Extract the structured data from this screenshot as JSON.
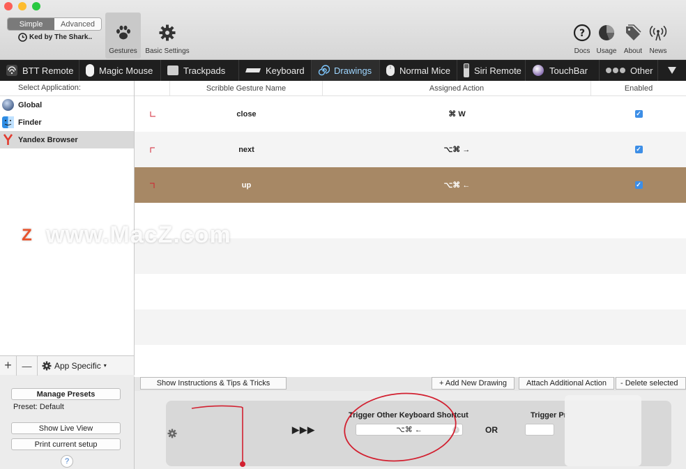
{
  "toolbar": {
    "mode_simple": "Simple",
    "mode_advanced": "Advanced",
    "user": "Ked by The Shark..",
    "gestures": "Gestures",
    "basic_settings": "Basic Settings",
    "docs": "Docs",
    "usage": "Usage",
    "about": "About",
    "news": "News"
  },
  "tabs": [
    {
      "label": "BTT Remote"
    },
    {
      "label": "Magic Mouse"
    },
    {
      "label": "Trackpads"
    },
    {
      "label": "Keyboard"
    },
    {
      "label": "Drawings"
    },
    {
      "label": "Normal Mice"
    },
    {
      "label": "Siri Remote"
    },
    {
      "label": "TouchBar"
    },
    {
      "label": "Other"
    }
  ],
  "sidebar": {
    "header": "Select Application:",
    "apps": [
      {
        "label": "Global"
      },
      {
        "label": "Finder"
      },
      {
        "label": "Yandex Browser"
      }
    ],
    "add": "+",
    "remove": "—",
    "app_specific": "App Specific"
  },
  "table": {
    "headers": {
      "name": "Scribble Gesture Name",
      "action": "Assigned Action",
      "enabled": "Enabled"
    },
    "rows": [
      {
        "name": "close",
        "action": "⌘ W",
        "enabled": "✓"
      },
      {
        "name": "next",
        "action": "⌥⌘ →",
        "enabled": "✓"
      },
      {
        "name": "up",
        "action": "⌥⌘ ←",
        "enabled": "✓"
      }
    ]
  },
  "actions": {
    "instructions": "Show Instructions & Tips & Tricks",
    "add_drawing": "+ Add New Drawing",
    "attach": "Attach Additional Action",
    "delete": "- Delete selected"
  },
  "presets": {
    "manage": "Manage Presets",
    "preset": "Preset: Default",
    "live_view": "Show Live View",
    "print": "Print current setup",
    "help": "?"
  },
  "panel": {
    "arrows": "▶▶▶",
    "trigger_label": "Trigger Other Keyboard Shortcut",
    "shortcut": "⌥⌘ ←",
    "or": "OR",
    "trigger_partial": "Trigger Pr"
  },
  "watermark": {
    "logo": "Z",
    "text": "www.MacZ.com"
  },
  "colors": {
    "selected_row": "#a78865",
    "tab_bar": "#1f1f1f",
    "checkbox": "#3d8ee6",
    "annotation": "#d22030"
  }
}
